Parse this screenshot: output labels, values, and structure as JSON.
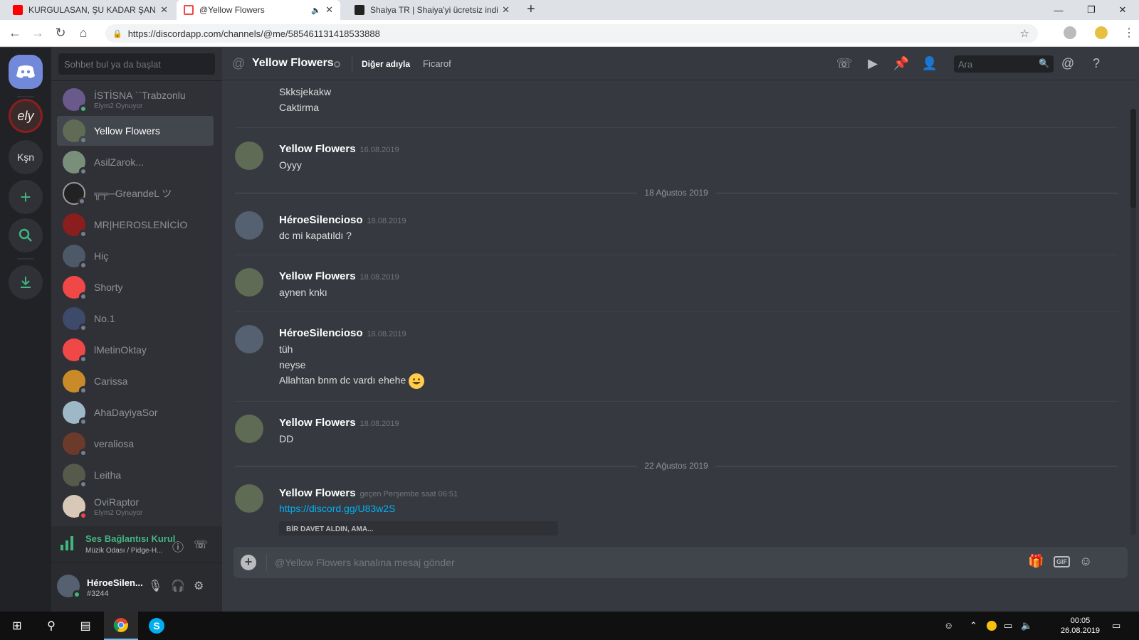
{
  "browser": {
    "tabs": [
      {
        "title": "KURGULASAN, ŞU KADAR ŞANSSIZ",
        "icon": "youtube-icon"
      },
      {
        "title": "@Yellow Flowers",
        "icon": "discord-icon"
      },
      {
        "title": "Shaiya TR | Shaiya'yi ücretsiz indir",
        "icon": "shaiya-icon"
      }
    ],
    "url": "https://discordapp.com/channels/@me/585461131418533888"
  },
  "guilds": {
    "server_label": "Kşn"
  },
  "dm": {
    "search_placeholder": "Sohbet bul ya da başlat",
    "items": [
      {
        "name": "İSTİSNA ``Trabzonlu",
        "sub": "Elym2 Oynuyor",
        "status": "on"
      },
      {
        "name": "Yellow Flowers",
        "sub": "",
        "status": "off"
      },
      {
        "name": "AsilZarok...",
        "sub": "",
        "status": "off"
      },
      {
        "name": "╦╤─GreandeL ツ",
        "sub": "",
        "status": "off"
      },
      {
        "name": "MR|HEROSLENİCİO",
        "sub": "",
        "status": "off"
      },
      {
        "name": "Hiç",
        "sub": "",
        "status": "off"
      },
      {
        "name": "Shorty",
        "sub": "",
        "status": "off"
      },
      {
        "name": "No.1",
        "sub": "",
        "status": "off"
      },
      {
        "name": "lMetinOktay",
        "sub": "",
        "status": "off"
      },
      {
        "name": "Carissa",
        "sub": "",
        "status": "off"
      },
      {
        "name": "AhaDayiyaSor",
        "sub": "",
        "status": "off"
      },
      {
        "name": "veraliosa",
        "sub": "",
        "status": "off"
      },
      {
        "name": "Leitha",
        "sub": "",
        "status": "off"
      },
      {
        "name": "OviRaptor",
        "sub": "Elym2 Oynuyor",
        "status": "dnd"
      }
    ]
  },
  "voice": {
    "title": "Ses Bağlantısı Kurul",
    "sub": "Müzik Odası / Pidge-H..."
  },
  "user": {
    "name": "HéroeSilen...",
    "discriminator": "#3244"
  },
  "header": {
    "channel": "Yellow Flowers",
    "alias_label": "Diğer adıyla",
    "alias": "Ficarof",
    "search_placeholder": "Ara"
  },
  "messages": {
    "pre_lines": [
      "Skksjekakw",
      "Caktirma"
    ],
    "groups": [
      {
        "author": "Yellow Flowers",
        "time": "16.08.2019",
        "lines": [
          "Oyyy"
        ]
      },
      {
        "author": "HéroeSilencioso",
        "time": "18.08.2019",
        "lines": [
          "dc mi kapatıldı ?"
        ]
      },
      {
        "author": "Yellow Flowers",
        "time": "18.08.2019",
        "lines": [
          "aynen knkı"
        ]
      },
      {
        "author": "HéroeSilencioso",
        "time": "18.08.2019",
        "lines": [
          "tüh",
          "neyse",
          "Allahtan bnm dc vardı ehehe"
        ]
      },
      {
        "author": "Yellow Flowers",
        "time": "18.08.2019",
        "lines": [
          "DD"
        ]
      },
      {
        "author": "Yellow Flowers",
        "time": "geçen Perşembe saat 06:51",
        "lines": [
          "https://discord.gg/U83w2S"
        ]
      }
    ],
    "date_separators": [
      "18 Ağustos 2019",
      "22 Ağustos 2019"
    ],
    "embed_title": "BİR DAVET ALDIN, AMA..."
  },
  "composer": {
    "placeholder": "@Yellow Flowers kanalına mesaj gönder",
    "gif_label": "GIF"
  },
  "taskbar": {
    "time": "00:05",
    "date": "26.08.2019"
  },
  "colors": {
    "blurple": "#7289da",
    "online": "#43b581",
    "dnd": "#f04747",
    "link": "#00b0f4"
  }
}
